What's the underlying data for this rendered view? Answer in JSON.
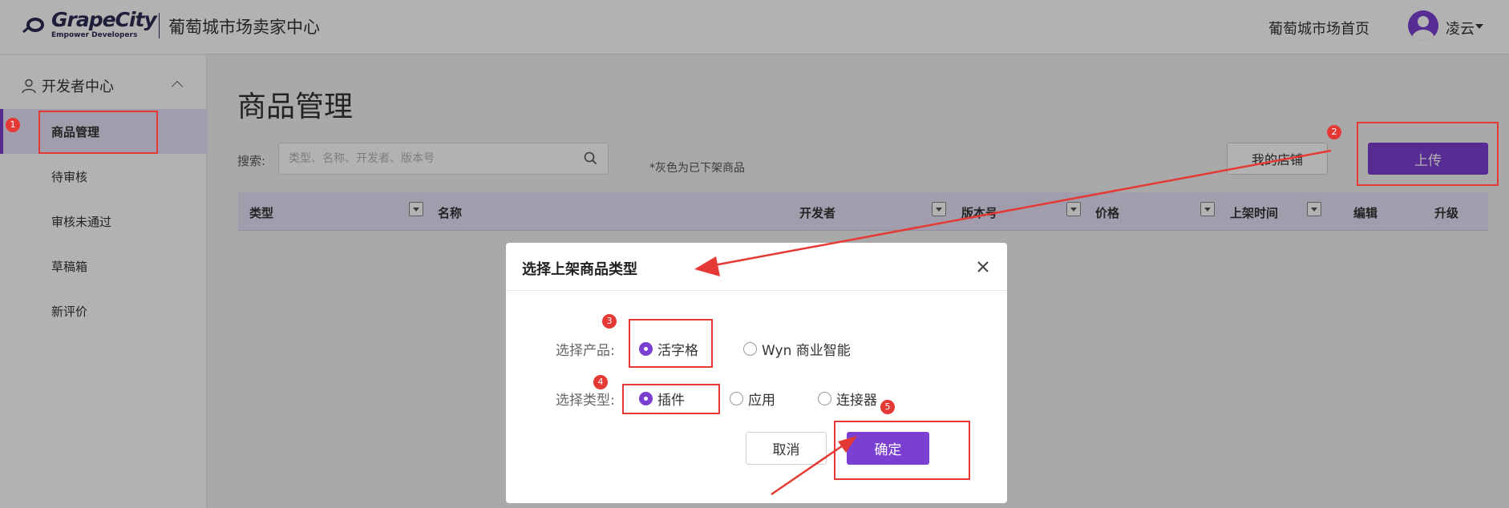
{
  "header": {
    "logo_text": "GrapeCity",
    "logo_tagline": "Empower Developers",
    "center_title": "葡萄城市场卖家中心",
    "home_link": "葡萄城市场首页",
    "username": "凌云"
  },
  "sidebar": {
    "section_title": "开发者中心",
    "items": [
      {
        "label": "商品管理"
      },
      {
        "label": "待审核"
      },
      {
        "label": "审核未通过"
      },
      {
        "label": "草稿箱"
      },
      {
        "label": "新评价"
      }
    ]
  },
  "main": {
    "title": "商品管理",
    "search_label": "搜索:",
    "search_placeholder": "类型、名称、开发者、版本号",
    "gray_hint": "*灰色为已下架商品",
    "my_store_button": "我的店铺",
    "upload_button": "上传",
    "table_headers": [
      "类型",
      "名称",
      "开发者",
      "版本号",
      "价格",
      "上架时间",
      "编辑",
      "升级"
    ]
  },
  "dialog": {
    "title": "选择上架商品类型",
    "product_label": "选择产品:",
    "product_options": [
      "活字格",
      "Wyn 商业智能"
    ],
    "product_selected": "活字格",
    "type_label": "选择类型:",
    "type_options": [
      "插件",
      "应用",
      "连接器"
    ],
    "type_selected": "插件",
    "cancel_button": "取消",
    "confirm_button": "确定"
  },
  "annotations": {
    "badges": [
      "1",
      "2",
      "3",
      "4",
      "5"
    ]
  },
  "colors": {
    "accent": "#7b3fd1",
    "active_bg": "#e9e1f7",
    "annotation_red": "#e53935"
  }
}
